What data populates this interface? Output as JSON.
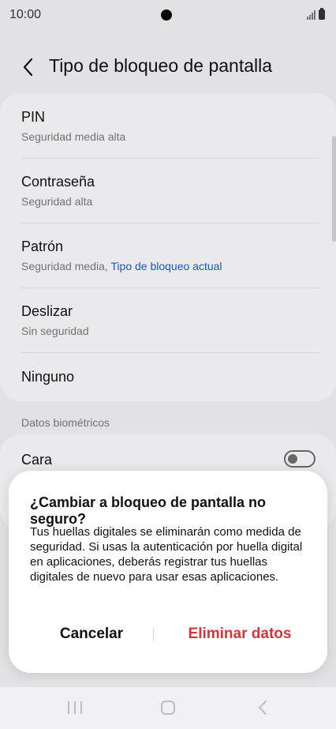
{
  "status_bar": {
    "time": "10:00",
    "icons": [
      "camera-dot",
      "signal-icon",
      "battery-icon"
    ]
  },
  "header": {
    "back_icon": "chevron-left-icon",
    "title": "Tipo de bloqueo de pantalla"
  },
  "lock_options": [
    {
      "title": "PIN",
      "subtitle": "Seguridad media alta"
    },
    {
      "title": "Contraseña",
      "subtitle": "Seguridad alta"
    },
    {
      "title": "Patrón",
      "subtitle": "Seguridad media,",
      "current": "Tipo de bloqueo actual"
    },
    {
      "title": "Deslizar",
      "subtitle": "Sin seguridad"
    },
    {
      "title": "Ninguno"
    }
  ],
  "biometrics": {
    "section_label": "Datos biométricos",
    "items": [
      {
        "label": "Cara",
        "enabled": false
      }
    ]
  },
  "dialog": {
    "title": "¿Cambiar a bloqueo de pantalla no seguro?",
    "body": "Tus huellas digitales se eliminarán como medida de seguridad. Si usas la autenticación por huella digital en aplicaciones, deberás registrar tus huellas digitales de nuevo para usar esas aplicaciones.",
    "cancel_label": "Cancelar",
    "confirm_label": "Eliminar datos"
  },
  "navigation_bar": {
    "icons": [
      "recent-apps-icon",
      "home-icon",
      "back-icon"
    ]
  },
  "colors": {
    "background": "#f1f1f3",
    "card": "#f9f9fb",
    "link_blue": "#1c5cd3",
    "destructive_red": "#d23636"
  }
}
